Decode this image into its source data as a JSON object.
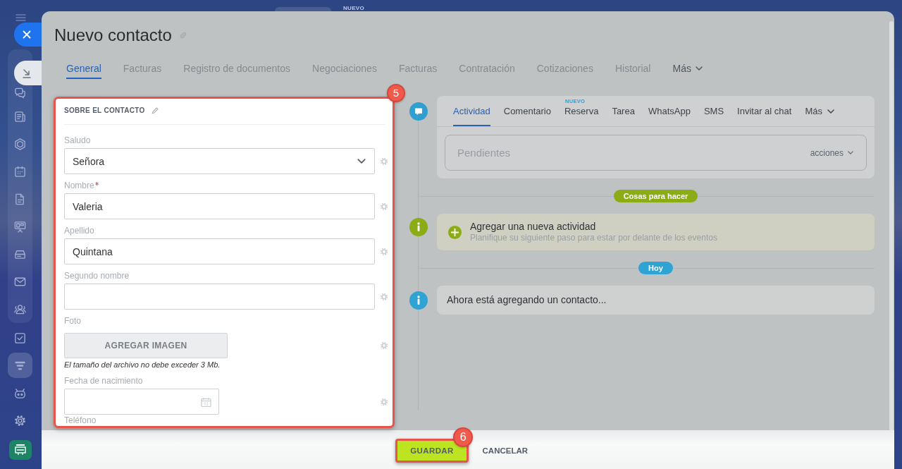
{
  "background": {
    "label": "NUEVO"
  },
  "sidebar": {
    "items": [
      {
        "selected": false
      },
      {
        "selected": false
      },
      {
        "selected": false
      },
      {
        "selected": false
      },
      {
        "selected": false
      },
      {
        "selected": false
      },
      {
        "selected": false
      },
      {
        "selected": false
      },
      {
        "selected": false
      },
      {
        "selected": false
      },
      {
        "selected": true
      },
      {
        "selected": false
      },
      {
        "selected": false
      }
    ]
  },
  "panel": {
    "title": "Nuevo contacto",
    "tabs": [
      {
        "label": "General",
        "kind": "tab",
        "selected": true
      },
      {
        "label": "Facturas",
        "kind": "tab",
        "selected": false
      },
      {
        "label": "Registro de documentos",
        "kind": "tab",
        "selected": false
      },
      {
        "label": "Negociaciones",
        "kind": "tab",
        "selected": false
      },
      {
        "label": "Facturas",
        "kind": "tab",
        "selected": false
      },
      {
        "label": "Contratación",
        "kind": "tab",
        "selected": false
      },
      {
        "label": "Cotizaciones",
        "kind": "tab",
        "selected": false
      },
      {
        "label": "Historial",
        "kind": "tab",
        "selected": false
      },
      {
        "label": "Más",
        "kind": "menu",
        "selected": false
      }
    ]
  },
  "form": {
    "step": "5",
    "highlighted": true,
    "title": "SOBRE EL CONTACTO",
    "fields": [
      {
        "kind": "select",
        "label": "Saludo",
        "required": false,
        "value": "Señora"
      },
      {
        "kind": "text",
        "label": "Nombre",
        "required": true,
        "value": "Valeria"
      },
      {
        "kind": "text",
        "label": "Apellido",
        "required": false,
        "value": "Quintana"
      },
      {
        "kind": "text",
        "label": "Segundo nombre",
        "required": false
      },
      {
        "kind": "upload",
        "label": "Foto",
        "required": false,
        "button": "AGREGAR IMAGEN",
        "hint": "El tamaño del archivo no debe exceder 3 Mb."
      },
      {
        "kind": "date",
        "label": "Fecha de nacimiento",
        "required": false
      },
      {
        "kind": "partial",
        "label": "Teléfono",
        "required": false
      }
    ]
  },
  "timeline": {
    "composer": {
      "tabs": [
        {
          "label": "Actividad",
          "kind": "tab",
          "selected": true
        },
        {
          "label": "Comentario",
          "kind": "tab",
          "selected": false
        },
        {
          "label": "Reserva",
          "kind": "tab",
          "selected": false,
          "badge": "NUEVO"
        },
        {
          "label": "Tarea",
          "kind": "tab",
          "selected": false
        },
        {
          "label": "WhatsApp",
          "kind": "tab",
          "selected": false
        },
        {
          "label": "SMS",
          "kind": "tab",
          "selected": false
        },
        {
          "label": "Invitar al chat",
          "kind": "tab",
          "selected": false
        },
        {
          "label": "Más",
          "kind": "menu",
          "selected": false
        }
      ],
      "placeholder": "Pendientes",
      "actions": "acciones"
    },
    "groups": [
      {
        "label": "Cosas para hacer",
        "color": "#8aac14",
        "items": [
          {
            "kind": "add",
            "title": "Agregar una nueva actividad",
            "subtitle": "Planifique su siguiente paso para estar por delante de los eventos"
          }
        ]
      },
      {
        "label": "Hoy",
        "color": "#2fa3d3",
        "items": [
          {
            "kind": "info",
            "title": "Ahora está agregando un contacto..."
          }
        ]
      }
    ]
  },
  "footer": {
    "buttons": [
      {
        "label": "GUARDAR",
        "kind": "primary",
        "highlighted": true,
        "step": "6"
      },
      {
        "label": "CANCELAR",
        "kind": "link",
        "highlighted": false
      }
    ]
  }
}
